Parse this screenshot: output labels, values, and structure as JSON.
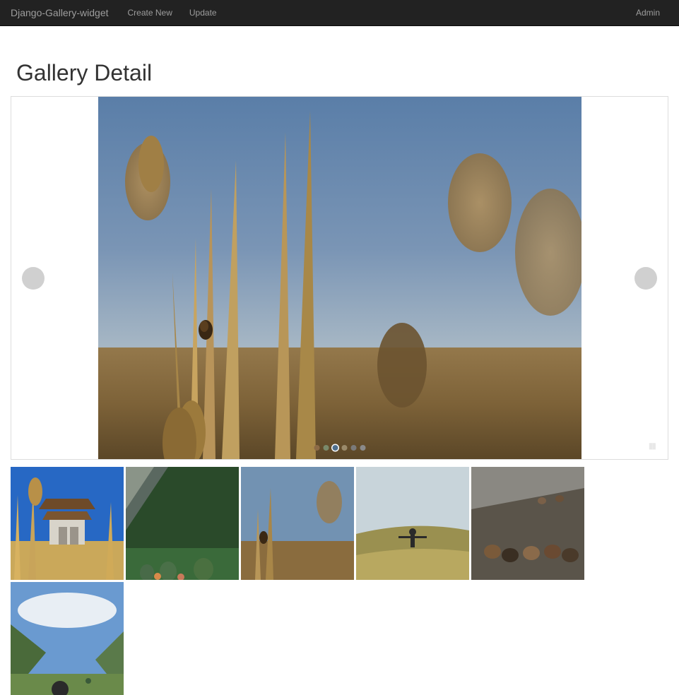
{
  "navbar": {
    "brand": "Django-Gallery-widget",
    "links": [
      "Create New",
      "Update"
    ],
    "right_links": [
      "Admin"
    ]
  },
  "page_title": "Gallery Detail",
  "carousel": {
    "active_index": 2,
    "dot_colors": [
      "#8c6b47",
      "#7a8a6b",
      "#4e6f8e",
      "#9a8a6a",
      "#7a7a7a",
      "#8a8a8a"
    ],
    "dot_active_border": "#ffffff"
  },
  "thumbs": [
    {
      "name": "thumb-temple-grass"
    },
    {
      "name": "thumb-mountain-forest"
    },
    {
      "name": "thumb-wheat-bug"
    },
    {
      "name": "thumb-person-field"
    },
    {
      "name": "thumb-horses-fog"
    },
    {
      "name": "thumb-valley-sky"
    }
  ]
}
